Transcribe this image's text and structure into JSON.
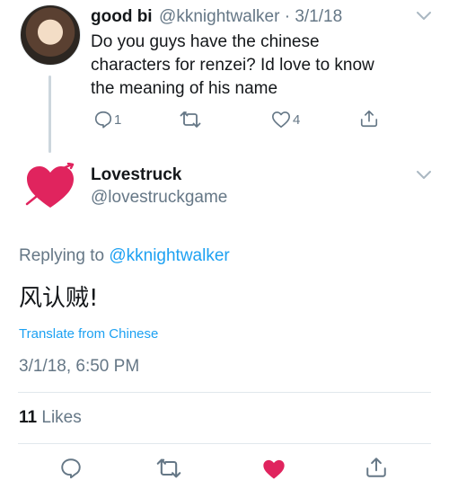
{
  "first_tweet": {
    "display_name": "good bi",
    "handle_date": "@kknightwalker · 3/1/18",
    "text_line1": "Do you guys have the chinese",
    "text_line2": "characters for renzei? Id love to know",
    "text_line3": "the meaning of his name",
    "reply_count": "1",
    "like_count": "4"
  },
  "main_tweet": {
    "display_name": "Lovestruck",
    "handle": "@lovestruckgame",
    "replying_label": "Replying to",
    "replying_handle": "@kknightwalker",
    "text": "风认贼!",
    "translate": "Translate from Chinese",
    "timestamp": "3/1/18, 6:50 PM",
    "likes_count": "11",
    "likes_label": "Likes"
  },
  "colors": {
    "link": "#1da1f2",
    "heart": "#e0245e",
    "muted": "#657786"
  }
}
